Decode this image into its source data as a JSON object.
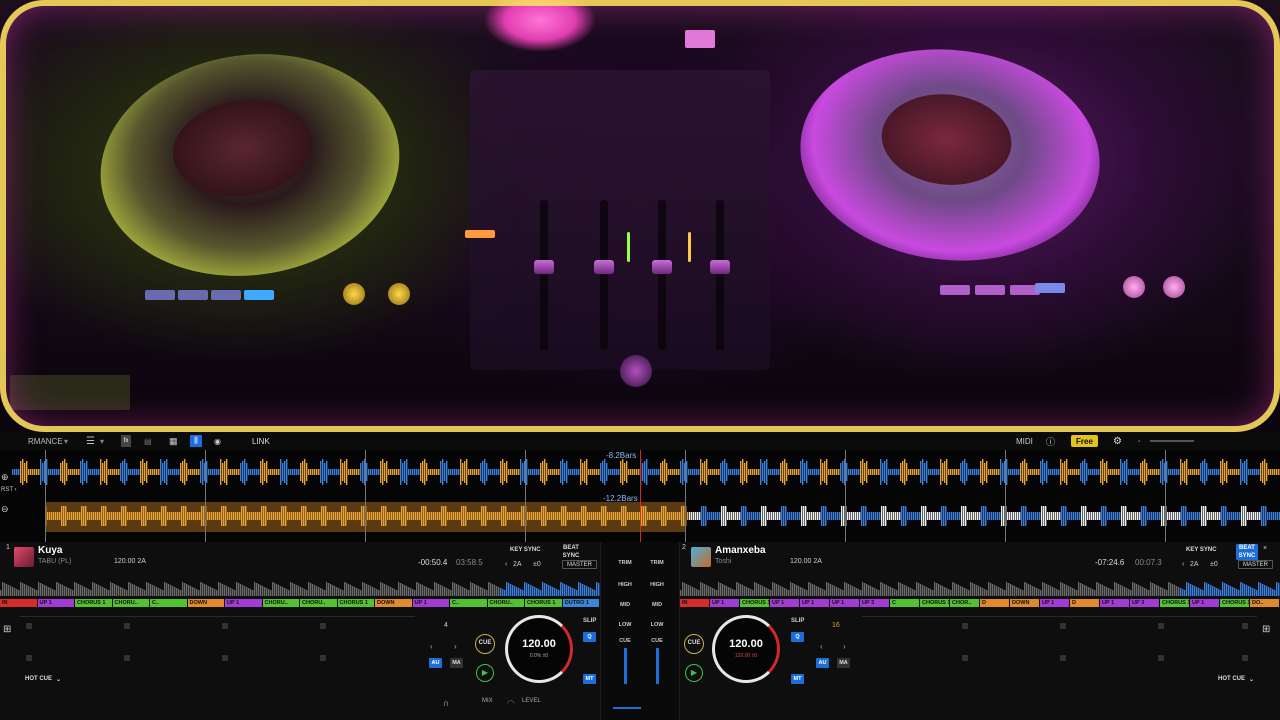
{
  "toolbar": {
    "mode_label": "RMANCE",
    "link_label": "LINK",
    "midi_label": "MIDI",
    "free_label": "Free"
  },
  "overview": {
    "deck1_bars": "-8.2Bars",
    "deck2_bars": "-12.2Bars"
  },
  "deck_left": {
    "number": "1",
    "title": "Kuya",
    "artist": "TABU (PL)",
    "bpm_key": "120.00  2A",
    "time_remaining": "-00:50.4",
    "time_total": "03:58.5",
    "key_sync_label": "KEY SYNC",
    "beat_sync_label": "BEAT SYNC",
    "key_value": "2A",
    "key_offset": "±0",
    "master_label": "MASTER",
    "phrases": [
      "IN",
      "UP 1",
      "CHORUS 1",
      "CHORU..",
      "C..",
      "DOWN",
      "UP 1",
      "CHORU..",
      "CHORU..",
      "CHORUS 1",
      "DOWN",
      "UP 1",
      "C..",
      "CHORU..",
      "CHORUS 1",
      "OUTRO 1"
    ],
    "beat_counter": "4",
    "cue_label": "CUE",
    "slip_label": "SLIP",
    "q_label": "Q",
    "au_label": "AU",
    "ma_label": "MA",
    "mt_label": "MT",
    "jog_bpm": "120.00",
    "jog_pct": "0.0%  ±0",
    "hot_cue_label": "HOT CUE"
  },
  "deck_right": {
    "number": "2",
    "title": "Amanxeba",
    "artist": "Toshi",
    "bpm_key": "120.00  2A",
    "time_remaining": "-07:24.6",
    "time_total": "00:07.3",
    "key_sync_label": "KEY SYNC",
    "beat_sync_label": "BEAT SYNC",
    "key_value": "2A",
    "key_offset": "±0",
    "master_label": "MASTER",
    "phrases": [
      "IN",
      "UP 1",
      "CHORUS 1",
      "UP 1",
      "UP 1",
      "UP 1",
      "UP 3",
      "C",
      "CHORUS 1",
      "CHOR..",
      "D",
      "DOWN",
      "UP 1",
      "D",
      "UP 1",
      "UP 3",
      "CHORUS 1",
      "UP 1",
      "CHORUS 1",
      "DO.."
    ],
    "beat_counter": "16",
    "cue_label": "CUE",
    "slip_label": "SLIP",
    "q_label": "Q",
    "au_label": "AU",
    "ma_label": "MA",
    "mt_label": "MT",
    "jog_bpm": "120.00",
    "jog_pct": "120.00  ±0",
    "hot_cue_label": "HOT CUE"
  },
  "mixer": {
    "trim_label": "TRIM",
    "high_label": "HIGH",
    "mid_label": "MID",
    "low_label": "LOW",
    "cue_label": "CUE",
    "mix_label": "MIX",
    "level_label": "LEVEL"
  },
  "colors": {
    "accent_blue": "#1d6ed8",
    "free_yellow": "#e3c21b",
    "wave_blue": "#3b7fe0",
    "wave_orange": "#e8a23a",
    "phrase_green": "#52c22f",
    "phrase_purple": "#a43bd6",
    "phrase_orange": "#e08a2c",
    "phrase_red": "#d62c2c",
    "phrase_blue": "#3a86d9"
  }
}
